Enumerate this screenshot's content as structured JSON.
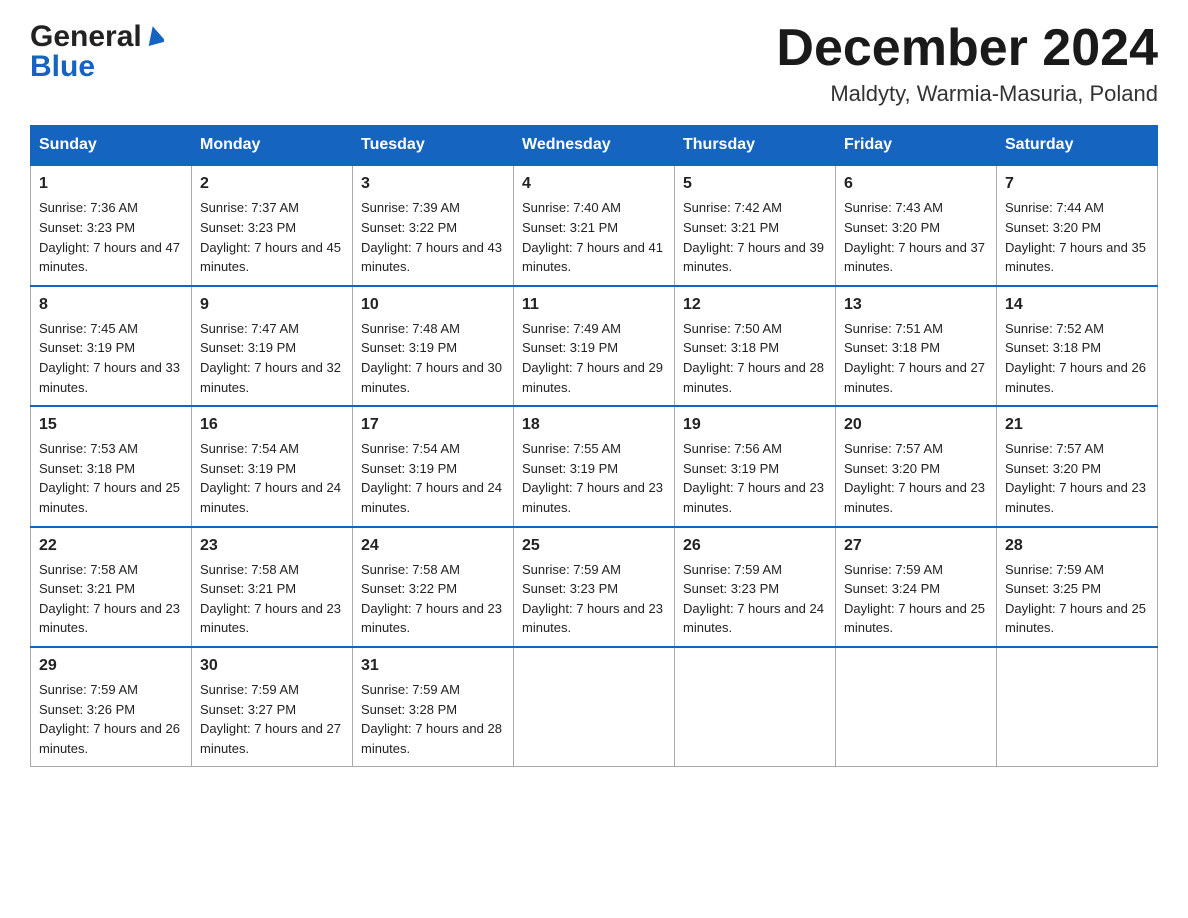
{
  "header": {
    "logo_line1": "General",
    "logo_line2": "Blue",
    "month_title": "December 2024",
    "location": "Maldyty, Warmia-Masuria, Poland"
  },
  "days_of_week": [
    "Sunday",
    "Monday",
    "Tuesday",
    "Wednesday",
    "Thursday",
    "Friday",
    "Saturday"
  ],
  "weeks": [
    [
      {
        "day": "1",
        "sunrise": "7:36 AM",
        "sunset": "3:23 PM",
        "daylight": "7 hours and 47 minutes."
      },
      {
        "day": "2",
        "sunrise": "7:37 AM",
        "sunset": "3:23 PM",
        "daylight": "7 hours and 45 minutes."
      },
      {
        "day": "3",
        "sunrise": "7:39 AM",
        "sunset": "3:22 PM",
        "daylight": "7 hours and 43 minutes."
      },
      {
        "day": "4",
        "sunrise": "7:40 AM",
        "sunset": "3:21 PM",
        "daylight": "7 hours and 41 minutes."
      },
      {
        "day": "5",
        "sunrise": "7:42 AM",
        "sunset": "3:21 PM",
        "daylight": "7 hours and 39 minutes."
      },
      {
        "day": "6",
        "sunrise": "7:43 AM",
        "sunset": "3:20 PM",
        "daylight": "7 hours and 37 minutes."
      },
      {
        "day": "7",
        "sunrise": "7:44 AM",
        "sunset": "3:20 PM",
        "daylight": "7 hours and 35 minutes."
      }
    ],
    [
      {
        "day": "8",
        "sunrise": "7:45 AM",
        "sunset": "3:19 PM",
        "daylight": "7 hours and 33 minutes."
      },
      {
        "day": "9",
        "sunrise": "7:47 AM",
        "sunset": "3:19 PM",
        "daylight": "7 hours and 32 minutes."
      },
      {
        "day": "10",
        "sunrise": "7:48 AM",
        "sunset": "3:19 PM",
        "daylight": "7 hours and 30 minutes."
      },
      {
        "day": "11",
        "sunrise": "7:49 AM",
        "sunset": "3:19 PM",
        "daylight": "7 hours and 29 minutes."
      },
      {
        "day": "12",
        "sunrise": "7:50 AM",
        "sunset": "3:18 PM",
        "daylight": "7 hours and 28 minutes."
      },
      {
        "day": "13",
        "sunrise": "7:51 AM",
        "sunset": "3:18 PM",
        "daylight": "7 hours and 27 minutes."
      },
      {
        "day": "14",
        "sunrise": "7:52 AM",
        "sunset": "3:18 PM",
        "daylight": "7 hours and 26 minutes."
      }
    ],
    [
      {
        "day": "15",
        "sunrise": "7:53 AM",
        "sunset": "3:18 PM",
        "daylight": "7 hours and 25 minutes."
      },
      {
        "day": "16",
        "sunrise": "7:54 AM",
        "sunset": "3:19 PM",
        "daylight": "7 hours and 24 minutes."
      },
      {
        "day": "17",
        "sunrise": "7:54 AM",
        "sunset": "3:19 PM",
        "daylight": "7 hours and 24 minutes."
      },
      {
        "day": "18",
        "sunrise": "7:55 AM",
        "sunset": "3:19 PM",
        "daylight": "7 hours and 23 minutes."
      },
      {
        "day": "19",
        "sunrise": "7:56 AM",
        "sunset": "3:19 PM",
        "daylight": "7 hours and 23 minutes."
      },
      {
        "day": "20",
        "sunrise": "7:57 AM",
        "sunset": "3:20 PM",
        "daylight": "7 hours and 23 minutes."
      },
      {
        "day": "21",
        "sunrise": "7:57 AM",
        "sunset": "3:20 PM",
        "daylight": "7 hours and 23 minutes."
      }
    ],
    [
      {
        "day": "22",
        "sunrise": "7:58 AM",
        "sunset": "3:21 PM",
        "daylight": "7 hours and 23 minutes."
      },
      {
        "day": "23",
        "sunrise": "7:58 AM",
        "sunset": "3:21 PM",
        "daylight": "7 hours and 23 minutes."
      },
      {
        "day": "24",
        "sunrise": "7:58 AM",
        "sunset": "3:22 PM",
        "daylight": "7 hours and 23 minutes."
      },
      {
        "day": "25",
        "sunrise": "7:59 AM",
        "sunset": "3:23 PM",
        "daylight": "7 hours and 23 minutes."
      },
      {
        "day": "26",
        "sunrise": "7:59 AM",
        "sunset": "3:23 PM",
        "daylight": "7 hours and 24 minutes."
      },
      {
        "day": "27",
        "sunrise": "7:59 AM",
        "sunset": "3:24 PM",
        "daylight": "7 hours and 25 minutes."
      },
      {
        "day": "28",
        "sunrise": "7:59 AM",
        "sunset": "3:25 PM",
        "daylight": "7 hours and 25 minutes."
      }
    ],
    [
      {
        "day": "29",
        "sunrise": "7:59 AM",
        "sunset": "3:26 PM",
        "daylight": "7 hours and 26 minutes."
      },
      {
        "day": "30",
        "sunrise": "7:59 AM",
        "sunset": "3:27 PM",
        "daylight": "7 hours and 27 minutes."
      },
      {
        "day": "31",
        "sunrise": "7:59 AM",
        "sunset": "3:28 PM",
        "daylight": "7 hours and 28 minutes."
      },
      null,
      null,
      null,
      null
    ]
  ]
}
